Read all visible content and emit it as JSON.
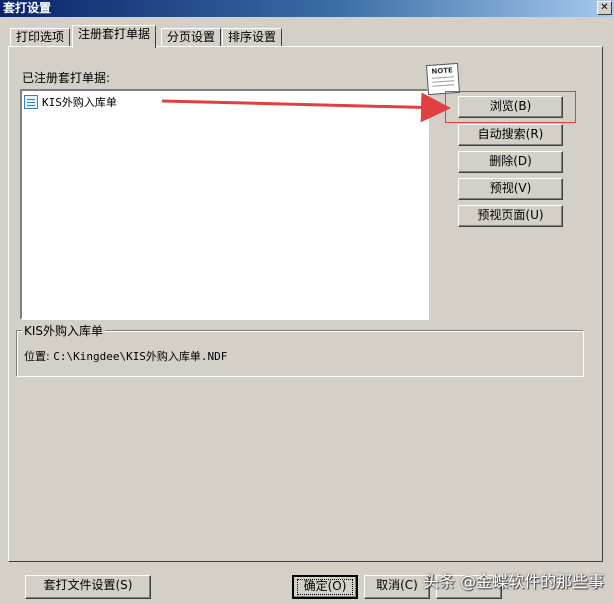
{
  "window": {
    "title": "套打设置",
    "close_label": "✕"
  },
  "tabs": [
    {
      "label": "打印选项"
    },
    {
      "label": "注册套打单据",
      "active": true
    },
    {
      "label": "分页设置"
    },
    {
      "label": "排序设置"
    }
  ],
  "registered": {
    "label": "已注册套打单据:",
    "items": [
      {
        "name": "KIS外购入库单"
      }
    ]
  },
  "note_icon": {
    "text": "NOTE"
  },
  "side_buttons": {
    "browse": "浏览(B)",
    "auto_search": "自动搜索(R)",
    "delete": "删除(D)",
    "preview": "预视(V)",
    "preview_page": "预视页面(U)"
  },
  "detail": {
    "title": "KIS外购入库单",
    "location_label": "位置:",
    "location_value": "C:\\Kingdee\\KIS外购入库单.NDF"
  },
  "footer": {
    "file_settings": "套打文件设置(S)",
    "ok": "确定(O)",
    "cancel": "取消(C)"
  },
  "watermark": "头条 @金蝶软件的那些事",
  "colors": {
    "annotation_red": "#e04040",
    "title_blue": "#0a246a"
  }
}
